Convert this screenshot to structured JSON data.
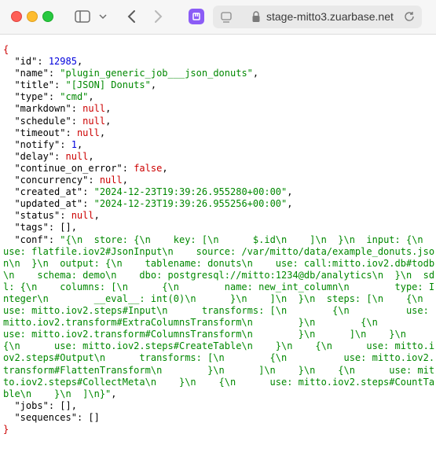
{
  "browser": {
    "url": "stage-mitto3.zuarbase.net"
  },
  "json": {
    "open_brace": "{",
    "close_brace": "}",
    "fields": [
      {
        "key": "\"id\"",
        "value": "12985",
        "type": "num"
      },
      {
        "key": "\"name\"",
        "value": "\"plugin_generic_job___json_donuts\"",
        "type": "str"
      },
      {
        "key": "\"title\"",
        "value": "\"[JSON] Donuts\"",
        "type": "str"
      },
      {
        "key": "\"type\"",
        "value": "\"cmd\"",
        "type": "str"
      },
      {
        "key": "\"markdown\"",
        "value": "null",
        "type": "nul"
      },
      {
        "key": "\"schedule\"",
        "value": "null",
        "type": "nul"
      },
      {
        "key": "\"timeout\"",
        "value": "null",
        "type": "nul"
      },
      {
        "key": "\"notify\"",
        "value": "1",
        "type": "num"
      },
      {
        "key": "\"delay\"",
        "value": "null",
        "type": "nul"
      },
      {
        "key": "\"continue_on_error\"",
        "value": "false",
        "type": "bool"
      },
      {
        "key": "\"concurrency\"",
        "value": "null",
        "type": "nul"
      },
      {
        "key": "\"created_at\"",
        "value": "\"2024-12-23T19:39:26.955280+00:00\"",
        "type": "str"
      },
      {
        "key": "\"updated_at\"",
        "value": "\"2024-12-23T19:39:26.955256+00:00\"",
        "type": "str"
      },
      {
        "key": "\"status\"",
        "value": "null",
        "type": "nul"
      },
      {
        "key": "\"tags\"",
        "value": "[]",
        "type": "punc"
      },
      {
        "key": "\"conf\"",
        "value": "\"{\\n  store: {\\n    key: [\\n      $.id\\n    ]\\n  }\\n  input: {\\n    use: flatfile.iov2#JsonInput\\n    source: /var/mitto/data/example_donuts.json\\n  }\\n  output: {\\n    tablename: donuts\\n    use: call:mitto.iov2.db#todb\\n    schema: demo\\n    dbo: postgresql://mitto:1234@db/analytics\\n  }\\n  sdl: {\\n    columns: [\\n      {\\n        name: new_int_column\\n        type: Integer\\n        __eval__: int(0)\\n      }\\n    ]\\n  }\\n  steps: [\\n    {\\n      use: mitto.iov2.steps#Input\\n      transforms: [\\n        {\\n          use: mitto.iov2.transform#ExtraColumnsTransform\\n        }\\n        {\\n          use: mitto.iov2.transform#ColumnsTransform\\n        }\\n      ]\\n    }\\n    {\\n      use: mitto.iov2.steps#CreateTable\\n    }\\n    {\\n      use: mitto.iov2.steps#Output\\n      transforms: [\\n        {\\n          use: mitto.iov2.transform#FlattenTransform\\n        }\\n      ]\\n    }\\n    {\\n      use: mitto.iov2.steps#CollectMeta\\n    }\\n    {\\n      use: mitto.iov2.steps#CountTable\\n    }\\n  ]\\n}\"",
        "type": "str"
      },
      {
        "key": "\"jobs\"",
        "value": "[]",
        "type": "punc"
      },
      {
        "key": "\"sequences\"",
        "value": "[]",
        "type": "punc",
        "last": true
      }
    ]
  },
  "colors": {
    "key": "#000000",
    "string": "#008800",
    "number": "#0000dd",
    "null": "#cc0000",
    "brace": "#cc0000"
  }
}
